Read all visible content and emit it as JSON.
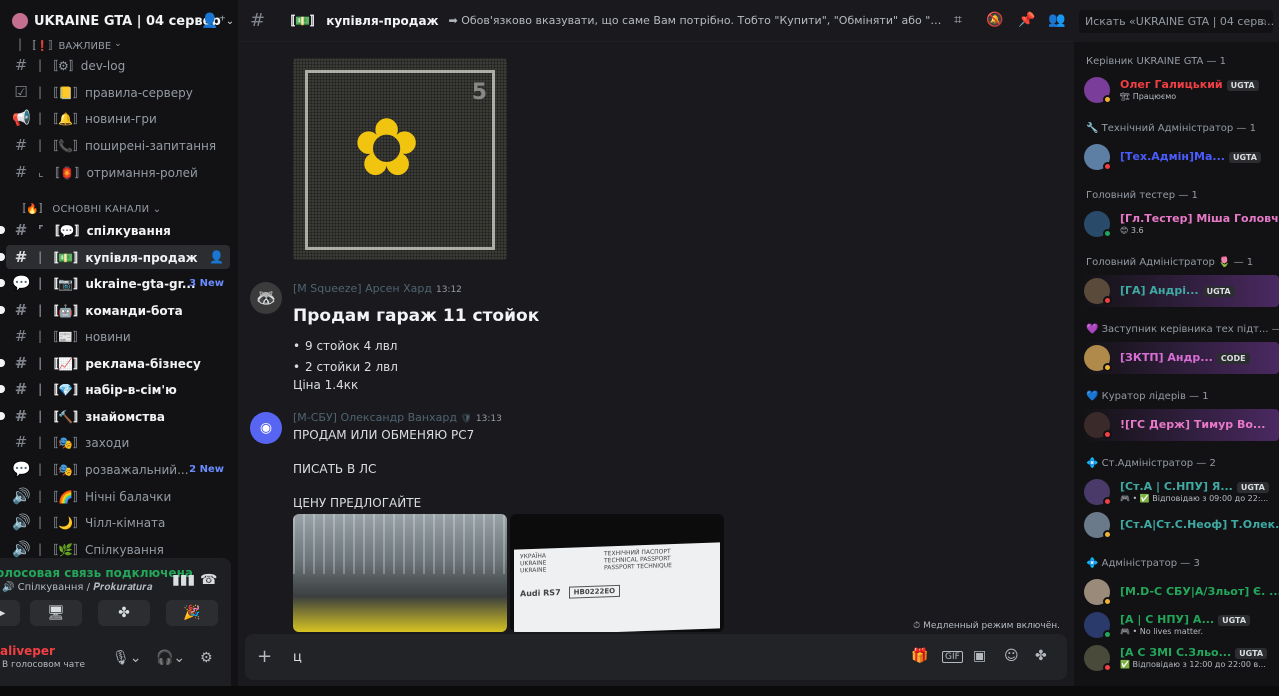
{
  "server": {
    "name": "UKRAINE GTA | 04 сервер",
    "chevron": "⌄"
  },
  "channels": [
    {
      "id": "vazhlyve",
      "kind": "category",
      "label": "〚❗〛ВАЖЛИВЕ"
    },
    {
      "id": "dev-log",
      "label": "〚⚙〛dev-log",
      "icon": "#"
    },
    {
      "id": "pravyla",
      "label": "〚📒〛правила-серверу",
      "icon": "☑"
    },
    {
      "id": "novyny-gry",
      "label": "〚🔔〛новини-гри",
      "icon": "📢"
    },
    {
      "id": "faq",
      "label": "〚📞〛поширені-запитання",
      "icon": "#"
    },
    {
      "id": "roles",
      "label": "〚🏮〛отримання-ролей",
      "icon": "#"
    },
    {
      "id": "osnovni",
      "kind": "category",
      "label": "〚🔥〛 ОСНОВНІ КАНАЛИ"
    },
    {
      "id": "spilkuvannia",
      "label": "〚💬〛спілкування",
      "icon": "#"
    },
    {
      "id": "kupivlia",
      "label": "〚💵〛купівля-продаж",
      "icon": "#"
    },
    {
      "id": "ukraine-gta-gr",
      "label": "〚📷〛ukraine-gta-gr...",
      "icon": "💬",
      "badge": "3 New"
    },
    {
      "id": "komandy-bota",
      "label": "〚🤖〛команди-бота",
      "icon": "#"
    },
    {
      "id": "novyny",
      "label": "〚📰〛новини",
      "icon": "#"
    },
    {
      "id": "reklama",
      "label": "〚📈〛реклама-бізнесу",
      "icon": "#"
    },
    {
      "id": "nabir",
      "label": "〚💎〛набір-в-сім'ю",
      "icon": "#"
    },
    {
      "id": "znaiomstva",
      "label": "〚🔨〛знайомства",
      "icon": "#"
    },
    {
      "id": "zakhody",
      "label": "〚🎭〛заходи",
      "icon": "#"
    },
    {
      "id": "rozvazhalnyi",
      "label": "〚🎭〛розважальний...",
      "icon": "💬",
      "badge": "2 New"
    },
    {
      "id": "nichni",
      "label": "〚🌈〛Нічні балачки",
      "icon": "🔊"
    },
    {
      "id": "chill",
      "label": "〚🌙〛Чілл-кімната",
      "icon": "🔊"
    },
    {
      "id": "spilk-voice",
      "label": "〚🌿〛Спілкування",
      "icon": "🔊"
    }
  ],
  "voice": {
    "status": "олосовая связь подключена",
    "channel": "Спілкування / 𝑷𝒓𝒐𝒌𝒖𝒓𝒂𝒕𝒖𝒓𝒂",
    "username": "aliveper",
    "user_status": "В голосовом чате"
  },
  "header": {
    "channel_title": "〚💵〛 купівля-продаж",
    "topic": "➡ Обов'язково вказувати, що саме Вам потрібно. Тобто \"Купити\", \"Обміняти\" або \"Продати\" ➡ Що сам...",
    "search_placeholder": "Искать «UKRAINE GTA | 04 серв..."
  },
  "messages": [
    {
      "author": "[M Squeeze] Арсен Хард",
      "time": "13:12",
      "title": "Продам гараж 11 стойок",
      "bullets": [
        "9 стойок 4 лвл",
        "2 стойки 2 лвл"
      ],
      "price": "Ціна 1.4кк"
    },
    {
      "author": "[M-СБУ] Олександр Ванхард",
      "time": "13:13",
      "lines": [
        "ПРОДАМ ИЛИ ОБМЕНЯЮ РС7",
        "ПИСАТЬ В ЛС",
        "ЦЕНУ ПРЕДЛОГАЙТЕ"
      ],
      "doc_text": "Audi RS7",
      "doc_plate": "НВ0222ЕО",
      "doc_lines": [
        "УКРАЇНА",
        "UKRAINE",
        "UKRAINE",
        "ТЕХНІЧНИЙ ПАСПОРТ",
        "TECHNICAL PASSPORT",
        "PASSPORT TECHNIQUE"
      ]
    }
  ],
  "slowmode": "Медленный режим включён.",
  "composer": {
    "typed": "ц"
  },
  "members": {
    "roles": [
      {
        "title": "Керівник UKRAINE GTA — 1",
        "members": [
          {
            "name": "Олег Галицький",
            "tag": "UGTA",
            "sub": "🏗 Працюємо",
            "color": "#f23f43",
            "avatar": "#7a3d9a",
            "status": "#f0b232"
          }
        ]
      },
      {
        "title": "🔧 Технічний Адміністратор — 1",
        "members": [
          {
            "name": "[Тех.Адмін]Ма...",
            "tag": "UGTA",
            "sub": "",
            "color": "#4a5cff",
            "avatar": "#5c7fa3",
            "status": "#f23f43"
          }
        ]
      },
      {
        "title": "Головний тестер — 1",
        "members": [
          {
            "name": "[Гл.Тестер] Міша Головч...",
            "tag": "",
            "sub": "😊 3.6",
            "color": "#e879c9",
            "avatar": "#2a4a6a",
            "status": "#23a55a"
          }
        ]
      },
      {
        "title": "Головний Адміністратор 🌷 — 1",
        "members": [
          {
            "name": "[ГА] Андрі...",
            "tag": "UGTA",
            "sub": "",
            "color": "#3fa9a3",
            "avatar": "#5a4a3a",
            "status": "#f23f43"
          }
        ]
      },
      {
        "title": "💜 Заступник керівника тех підт... — 1",
        "members": [
          {
            "name": "[ЗКТП] Андр...",
            "tag": "CODE",
            "sub": "",
            "color": "#d86fd6",
            "avatar": "#b08a4a",
            "status": "#f0b232"
          }
        ]
      },
      {
        "title": "💙 Куратор лідерів — 1",
        "members": [
          {
            "name": "![ГС Держ] Тимур Во...",
            "tag": "",
            "sub": "",
            "color": "#e879c9",
            "avatar": "#3a2a2a",
            "status": "#f23f43"
          }
        ]
      },
      {
        "title": "💠 Ст.Адміністратор — 2",
        "members": [
          {
            "name": "[Ст.А | С.НПУ] Я...",
            "tag": "UGTA",
            "sub": "🎮 • ✅ Відповідаю з 09:00 до 22:...",
            "color": "#3fa9a3",
            "avatar": "#4a3a6a",
            "status": "#f23f43"
          },
          {
            "name": "[Ст.А|Ст.С.Неоф] Т.Олек...",
            "tag": "",
            "sub": "",
            "color": "#3fa9a3",
            "avatar": "#6a7a8a",
            "status": "#f0b232"
          }
        ]
      },
      {
        "title": "💠 Адміністратор — 3",
        "members": [
          {
            "name": "[M.D-C СБУ|А/Зльот] Є. ...",
            "tag": "",
            "sub": "",
            "color": "#23a55a",
            "avatar": "#9a8a7a",
            "status": "#f0b232"
          },
          {
            "name": "[A | C НПУ] A...",
            "tag": "UGTA",
            "sub": "🎮 • No lives matter.",
            "color": "#23a55a",
            "avatar": "#2a3a6a",
            "status": "#23a55a"
          },
          {
            "name": "[A C ЗМІ С.Зльо...",
            "tag": "UGTA",
            "sub": "✅ Відповідаю з 12:00 до 22:00 в...",
            "color": "#23a55a",
            "avatar": "#4a4a3a",
            "status": "#f23f43"
          }
        ]
      }
    ]
  },
  "colors": {
    "accent": "#5865f2",
    "danger": "#f23f43",
    "online": "#23a55a",
    "idle": "#f0b232"
  }
}
